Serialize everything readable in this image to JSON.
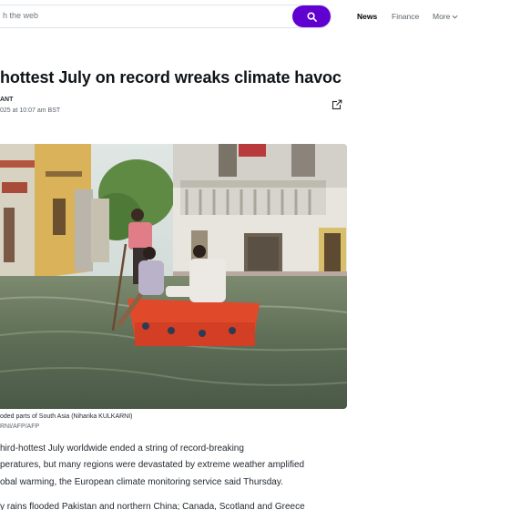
{
  "search": {
    "placeholder": "h the web"
  },
  "nav": {
    "news": "News",
    "finance": "Finance",
    "more": "More"
  },
  "article": {
    "headline": "hottest July on record wreaks climate havoc",
    "byline": "ANT",
    "date": "025 at 10:07 am BST",
    "caption": "oded parts of South Asia (Niharika KULKARNI)",
    "credit": "RNI/AFP/AFP",
    "paragraphs": [
      "hird-hottest July worldwide ended a string of record-breaking",
      "peratures, but many regions were devastated by extreme weather amplified",
      "obal warming, the European climate monitoring service said Thursday.",
      "y rains flooded Pakistan and northern China; Canada, Scotland and Greece"
    ]
  },
  "icons": {
    "search": "search-icon",
    "share": "external-link-icon",
    "more": "chevron-down-icon"
  },
  "colors": {
    "accent": "#6001d2",
    "text": "#232a31",
    "muted": "#5b636a"
  }
}
